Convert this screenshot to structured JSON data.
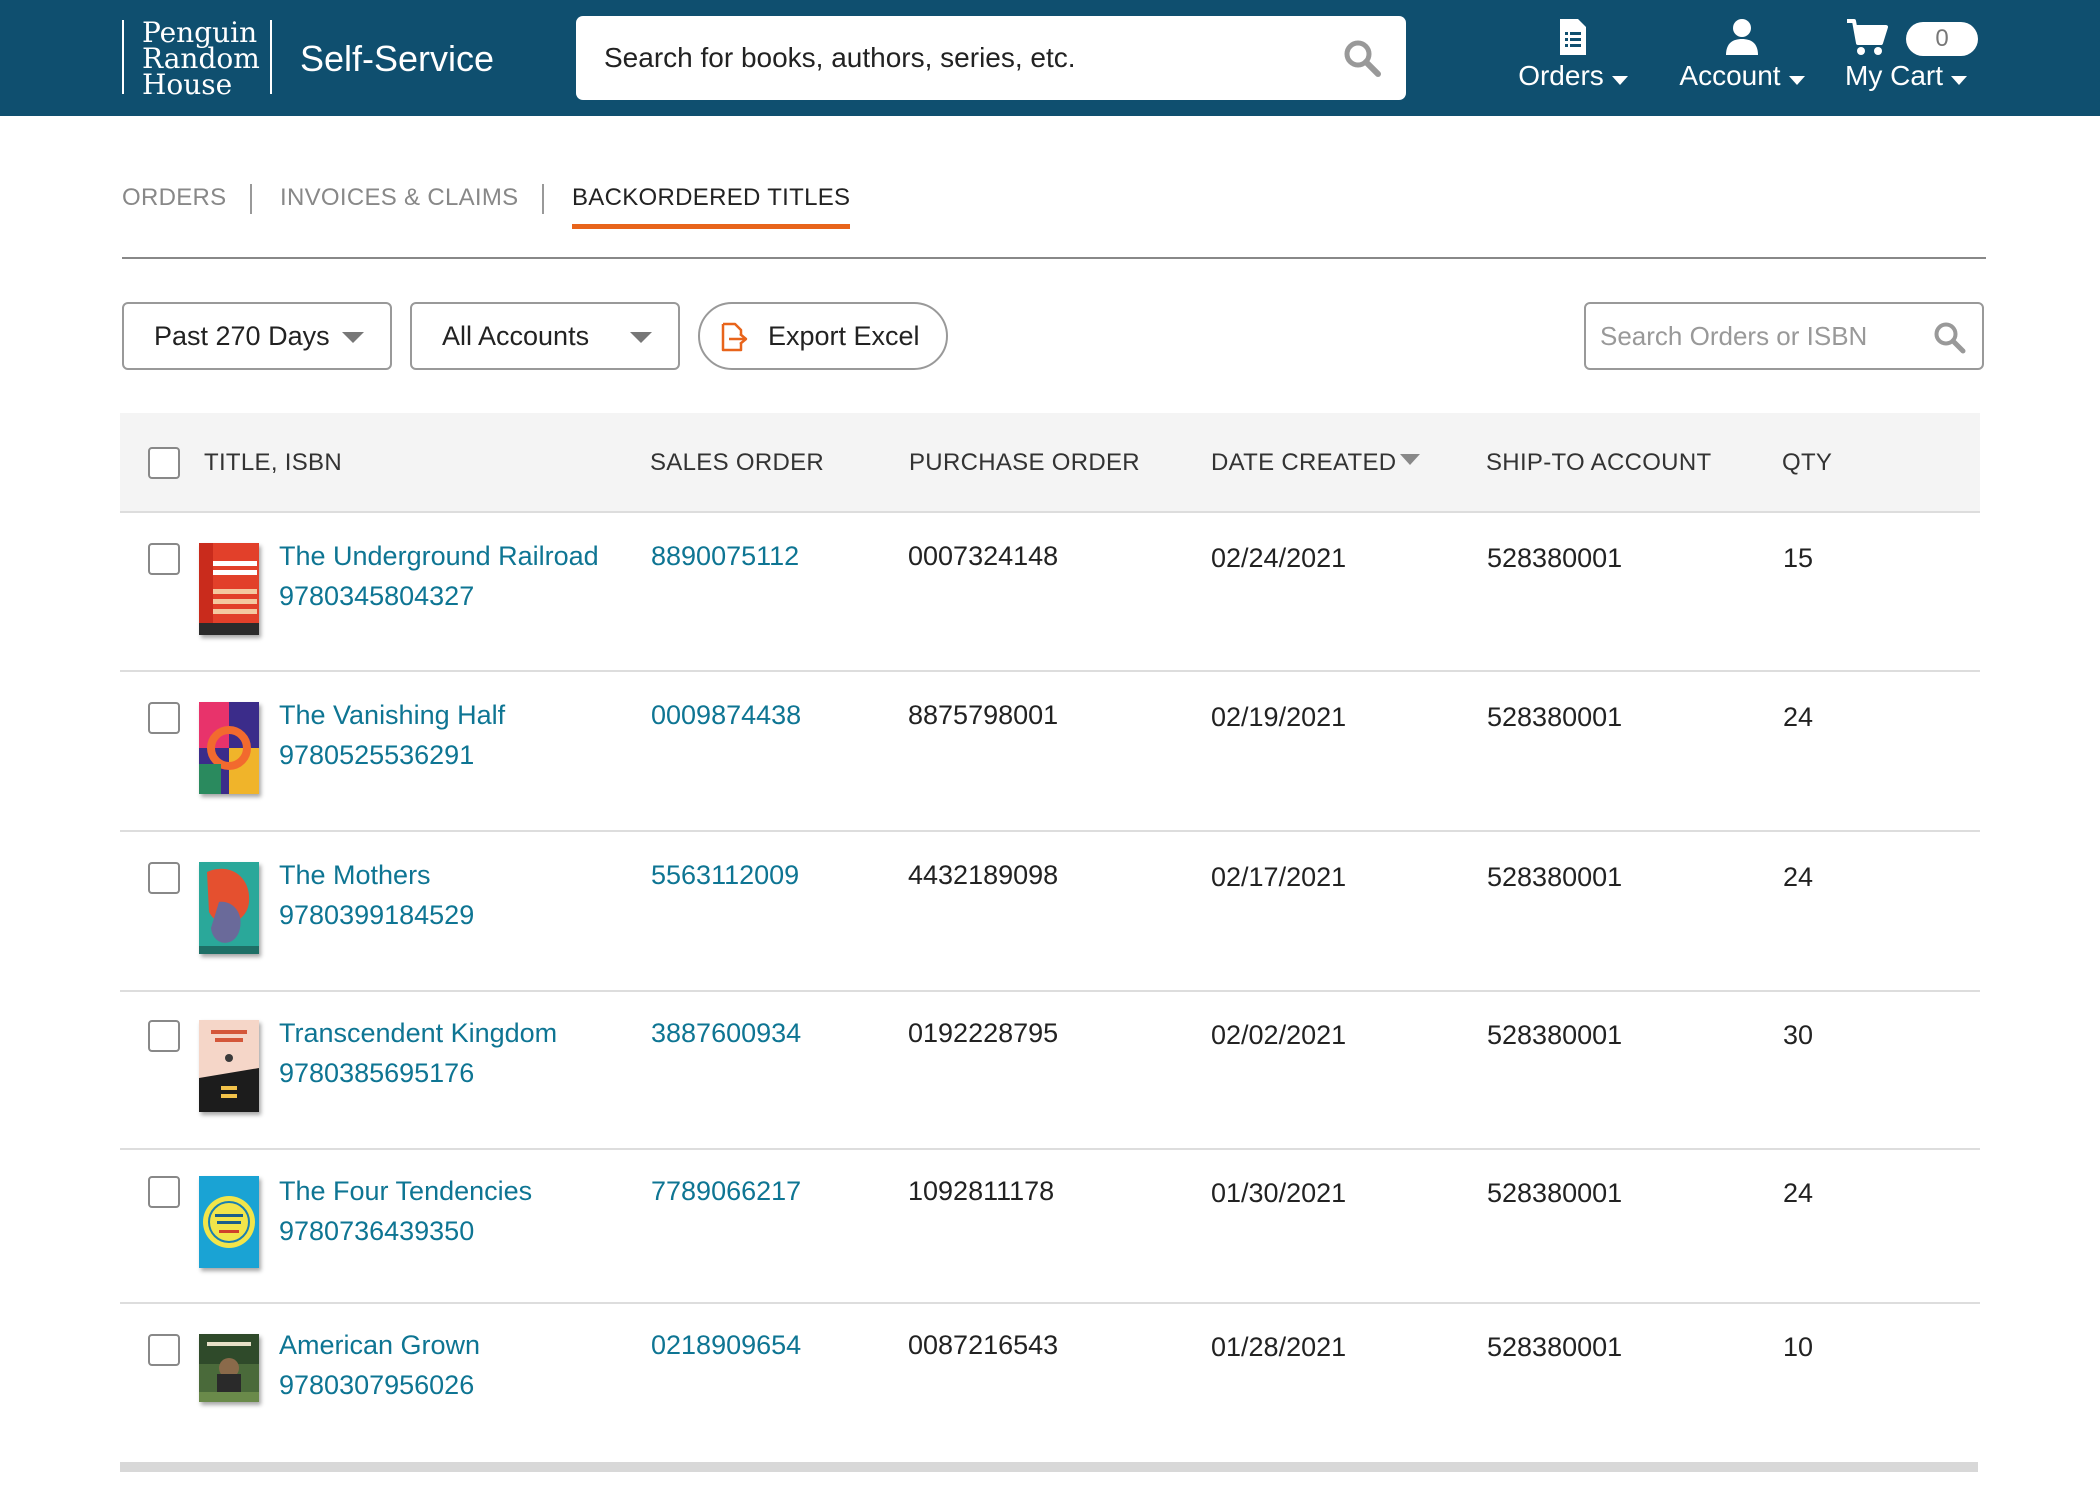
{
  "header": {
    "logo_lines": [
      "Penguin",
      "Random",
      "House"
    ],
    "app_title": "Self-Service",
    "search_placeholder": "Search for books, authors, series, etc.",
    "nav": {
      "orders_label": "Orders",
      "account_label": "Account",
      "cart_label": "My Cart",
      "cart_count": "0"
    }
  },
  "tabs": [
    {
      "label": "ORDERS",
      "active": false
    },
    {
      "label": "INVOICES & CLAIMS",
      "active": false
    },
    {
      "label": "BACKORDERED TITLES",
      "active": true
    }
  ],
  "toolbar": {
    "date_filter": "Past 270 Days",
    "account_filter": "All Accounts",
    "export_label": "Export Excel",
    "order_search_placeholder": "Search Orders or ISBN"
  },
  "table": {
    "columns": {
      "title": "TITLE, ISBN",
      "sales_order": "SALES ORDER",
      "purchase_order": "PURCHASE ORDER",
      "date_created": "DATE CREATED",
      "ship_to": "SHIP-TO ACCOUNT",
      "qty": "QTY"
    },
    "rows": [
      {
        "title": "The Underground Railroad",
        "isbn": "9780345804327",
        "sales_order": "8890075112",
        "purchase_order": "0007324148",
        "date_created": "02/24/2021",
        "ship_to": "528380001",
        "qty": "15"
      },
      {
        "title": "The Vanishing Half",
        "isbn": "9780525536291",
        "sales_order": "0009874438",
        "purchase_order": "8875798001",
        "date_created": "02/19/2021",
        "ship_to": "528380001",
        "qty": "24"
      },
      {
        "title": "The Mothers",
        "isbn": "9780399184529",
        "sales_order": "5563112009",
        "purchase_order": "4432189098",
        "date_created": "02/17/2021",
        "ship_to": "528380001",
        "qty": "24"
      },
      {
        "title": "Transcendent Kingdom",
        "isbn": "9780385695176",
        "sales_order": "3887600934",
        "purchase_order": "0192228795",
        "date_created": "02/02/2021",
        "ship_to": "528380001",
        "qty": "30"
      },
      {
        "title": "The Four Tendencies",
        "isbn": "9780736439350",
        "sales_order": "7789066217",
        "purchase_order": "1092811178",
        "date_created": "01/30/2021",
        "ship_to": "528380001",
        "qty": "24"
      },
      {
        "title": "American Grown",
        "isbn": "9780307956026",
        "sales_order": "0218909654",
        "purchase_order": "0087216543",
        "date_created": "01/28/2021",
        "ship_to": "528380001",
        "qty": "10"
      }
    ]
  },
  "colors": {
    "header_bg": "#0f4f6f",
    "link": "#0e7593",
    "accent": "#e8641b"
  }
}
